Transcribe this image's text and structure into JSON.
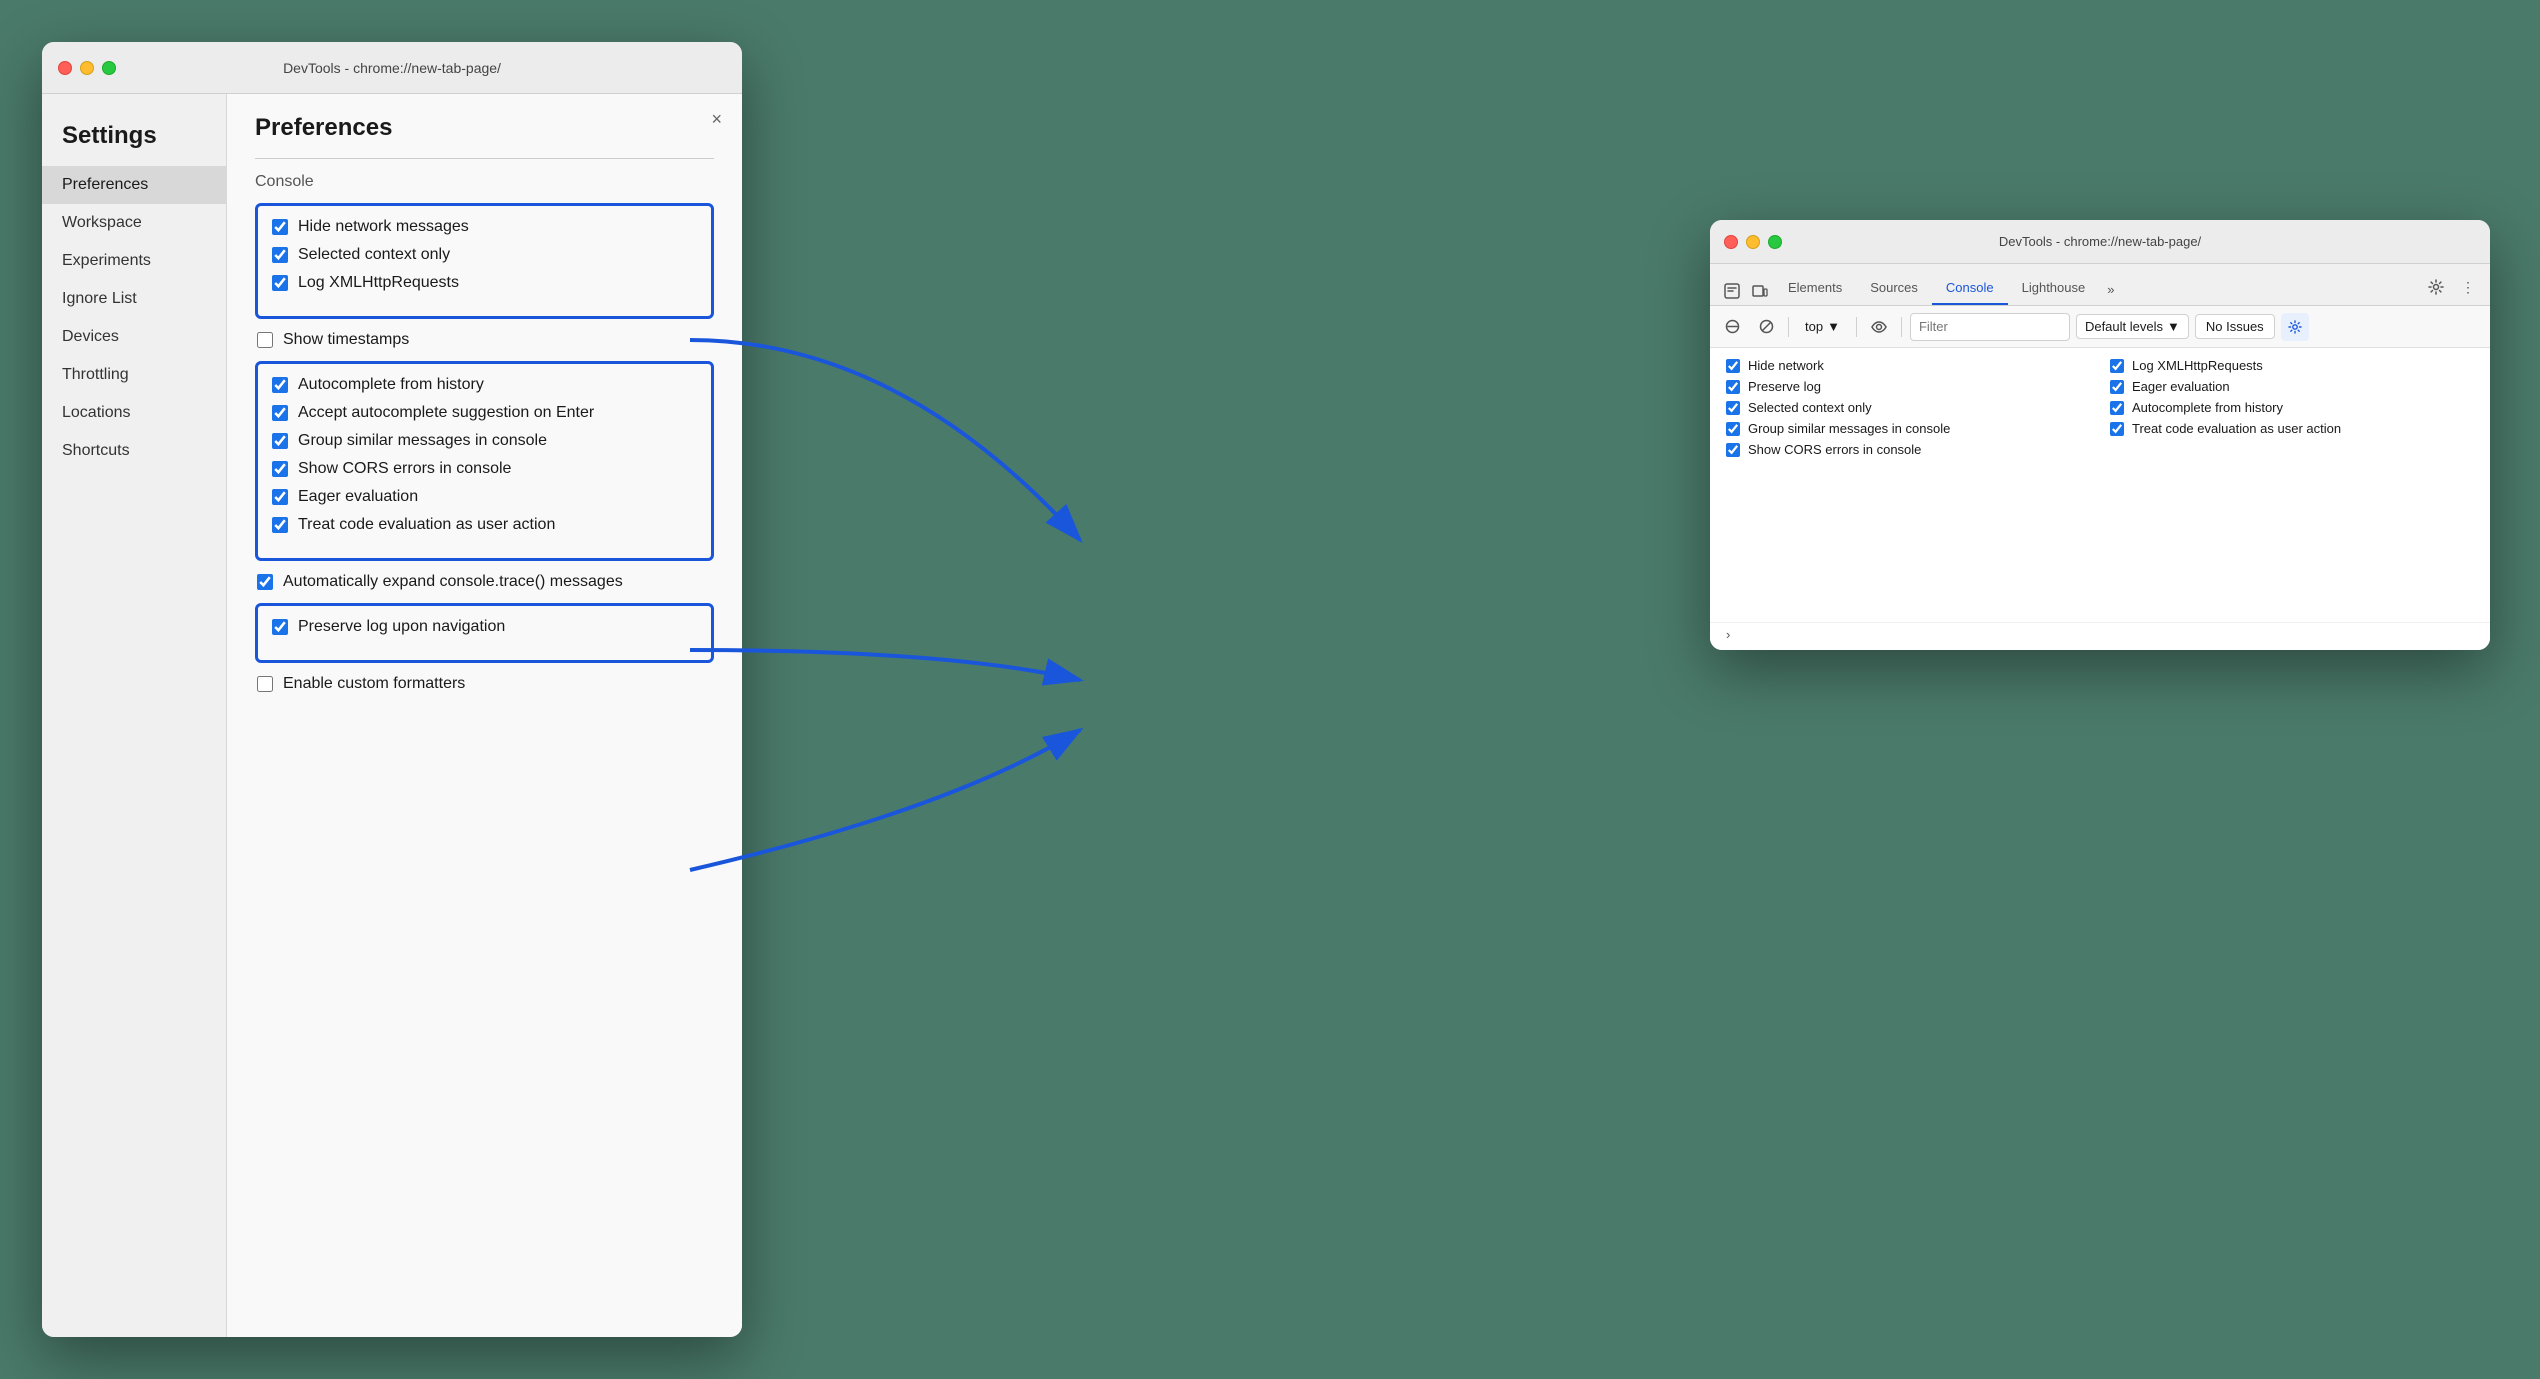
{
  "background_color": "#4a7a6a",
  "left_window": {
    "title": "DevTools - chrome://new-tab-page/",
    "traffic_lights": {
      "close": "close",
      "minimize": "minimize",
      "maximize": "maximize"
    },
    "sidebar": {
      "heading": "Settings",
      "items": [
        {
          "label": "Preferences",
          "active": true
        },
        {
          "label": "Workspace",
          "active": false
        },
        {
          "label": "Experiments",
          "active": false
        },
        {
          "label": "Ignore List",
          "active": false
        },
        {
          "label": "Devices",
          "active": false
        },
        {
          "label": "Throttling",
          "active": false
        },
        {
          "label": "Locations",
          "active": false
        },
        {
          "label": "Shortcuts",
          "active": false
        }
      ]
    },
    "content": {
      "title": "Preferences",
      "close_label": "×",
      "section_label": "Console",
      "box1_items": [
        {
          "label": "Hide network messages",
          "checked": true
        },
        {
          "label": "Selected context only",
          "checked": true
        },
        {
          "label": "Log XMLHttpRequests",
          "checked": true
        }
      ],
      "standalone1": {
        "label": "Show timestamps",
        "checked": false
      },
      "box2_items": [
        {
          "label": "Autocomplete from history",
          "checked": true
        },
        {
          "label": "Accept autocomplete suggestion on Enter",
          "checked": true
        },
        {
          "label": "Group similar messages in console",
          "checked": true
        },
        {
          "label": "Show CORS errors in console",
          "checked": true
        },
        {
          "label": "Eager evaluation",
          "checked": true
        },
        {
          "label": "Treat code evaluation as user action",
          "checked": true
        }
      ],
      "standalone2": {
        "label": "Automatically expand console.trace() messages",
        "checked": true
      },
      "box3_items": [
        {
          "label": "Preserve log upon navigation",
          "checked": true
        }
      ],
      "standalone3": {
        "label": "Enable custom formatters",
        "checked": false
      }
    }
  },
  "right_window": {
    "title": "DevTools - chrome://new-tab-page/",
    "tabs": [
      {
        "label": "Elements",
        "icon": "element-icon",
        "active": false
      },
      {
        "label": "Sources",
        "icon": "source-icon",
        "active": false
      },
      {
        "label": "Console",
        "icon": "",
        "active": true
      },
      {
        "label": "Lighthouse",
        "icon": "",
        "active": false
      },
      {
        "label": "»",
        "icon": "",
        "active": false
      }
    ],
    "toolbar": {
      "top_label": "top",
      "filter_placeholder": "Filter",
      "levels_label": "Default levels",
      "no_issues_label": "No Issues"
    },
    "console_items_left": [
      {
        "label": "Hide network",
        "checked": true
      },
      {
        "label": "Preserve log",
        "checked": true
      },
      {
        "label": "Selected context only",
        "checked": true
      },
      {
        "label": "Group similar messages in console",
        "checked": true
      },
      {
        "label": "Show CORS errors in console",
        "checked": true
      }
    ],
    "console_items_right": [
      {
        "label": "Log XMLHttpRequests",
        "checked": true
      },
      {
        "label": "Eager evaluation",
        "checked": true
      },
      {
        "label": "Autocomplete from history",
        "checked": true
      },
      {
        "label": "Treat code evaluation as user action",
        "checked": true
      }
    ]
  },
  "arrows": [
    {
      "id": "arrow1"
    },
    {
      "id": "arrow2"
    },
    {
      "id": "arrow3"
    }
  ]
}
